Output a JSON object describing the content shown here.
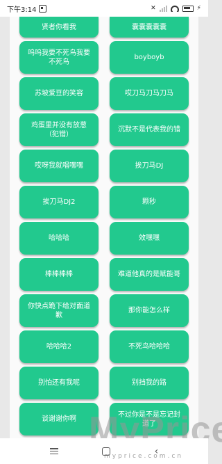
{
  "status_bar": {
    "time": "下午3:14"
  },
  "buttons": [
    [
      "贤者你看我",
      "囊囊囊囊囊"
    ],
    [
      "呜呜我要不死鸟我要不死鸟",
      "boyboyb"
    ],
    [
      "苏坡爱豆的笑容",
      "哎刀马刀马刀马"
    ],
    [
      "鸡蛋里并没有放葱（犯错）",
      "沉默不是代表我的错"
    ],
    [
      "哎呀我就唱嘿嘿",
      "挨刀马DJ"
    ],
    [
      "挨刀马DJ2",
      "颗秒"
    ],
    [
      "哈哈哈",
      "效嘿嘿"
    ],
    [
      "棒棒棒棒",
      "难道他真的是赋能哥"
    ],
    [
      "你快点跪下给对面道歉",
      "那你能怎么样"
    ],
    [
      "哈哈哈2",
      "不死鸟哈哈哈"
    ],
    [
      "别怕还有我呢",
      "别挡我的路"
    ],
    [
      "谈谢谢你啊",
      "不过你是不是忘记封道了"
    ]
  ],
  "watermark": {
    "main": "MyPrice",
    "sub": "myprice.com.cn"
  }
}
